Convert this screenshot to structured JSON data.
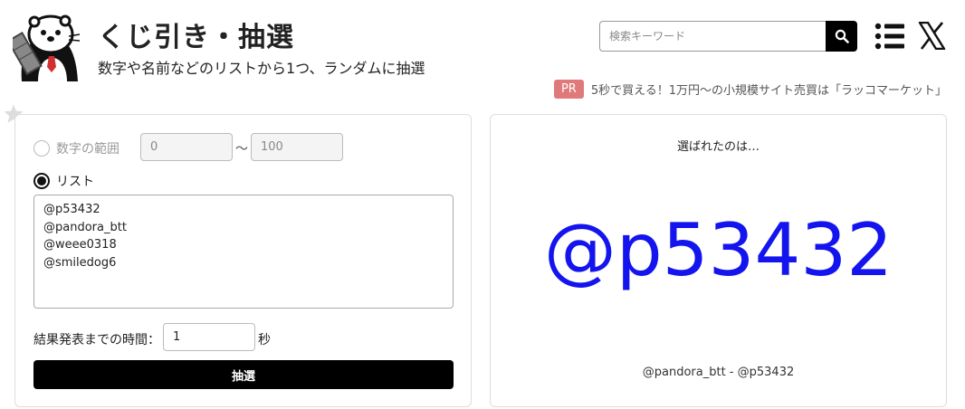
{
  "header": {
    "title": "くじ引き・抽選",
    "subtitle": "数字や名前などのリストから1つ、ランダムに抽選",
    "logo_icon": "otter-mascot-icon"
  },
  "search": {
    "placeholder": "検索キーワード",
    "icon": "search-icon"
  },
  "nav": {
    "menu_icon": "list-menu-icon",
    "social_icon": "x-logo-icon"
  },
  "pr": {
    "badge": "PR",
    "text": "5秒で買える！1万円〜の小規模サイト売買は「ラッコマーケット」",
    "badge_color": "#e07a7a"
  },
  "favorite_icon": "star-icon",
  "form": {
    "range_option": {
      "label": "数字の範囲",
      "checked": false,
      "min_value": "0",
      "max_value": "100",
      "separator": "〜"
    },
    "list_option": {
      "label": "リスト",
      "checked": true
    },
    "list_text": "@p53432\n@pandora_btt\n@weee0318\n@smiledog6",
    "time_label": "結果発表までの時間：",
    "time_value": "1",
    "time_unit": "秒",
    "draw_button": "抽選"
  },
  "result": {
    "label": "選ばれたのは…",
    "winner": "@p53432",
    "winner_color": "#1414ee",
    "history": "@pandora_btt - @p53432"
  }
}
